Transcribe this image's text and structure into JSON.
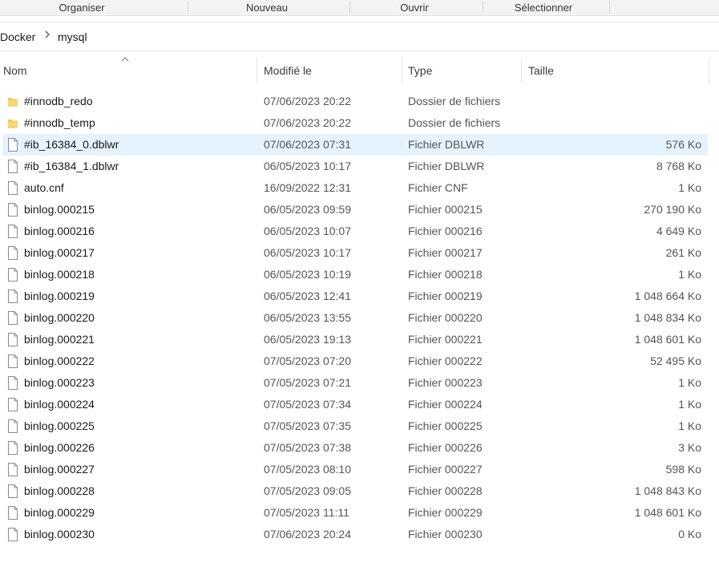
{
  "ribbon": {
    "organiser": "Organiser",
    "nouveau": "Nouveau",
    "ouvrir": "Ouvrir",
    "selectionner": "Sélectionner"
  },
  "breadcrumb": {
    "parent": "Docker",
    "current": "mysql"
  },
  "columns": {
    "name": "Nom",
    "modified": "Modifié le",
    "type": "Type",
    "size": "Taille"
  },
  "colors": {
    "selected_row": "#e5f3ff",
    "folder": "#f2c94c"
  },
  "files": [
    {
      "name": "#innodb_redo",
      "modified": "07/06/2023 20:22",
      "type": "Dossier de fichiers",
      "size": "",
      "icon": "folder-icon"
    },
    {
      "name": "#innodb_temp",
      "modified": "07/06/2023 20:22",
      "type": "Dossier de fichiers",
      "size": "",
      "icon": "folder-icon"
    },
    {
      "name": "#ib_16384_0.dblwr",
      "modified": "07/06/2023 07:31",
      "type": "Fichier DBLWR",
      "size": "576 Ko",
      "icon": "file-icon"
    },
    {
      "name": "#ib_16384_1.dblwr",
      "modified": "06/05/2023 10:17",
      "type": "Fichier DBLWR",
      "size": "8 768 Ko",
      "icon": "file-icon"
    },
    {
      "name": "auto.cnf",
      "modified": "16/09/2022 12:31",
      "type": "Fichier CNF",
      "size": "1 Ko",
      "icon": "file-icon"
    },
    {
      "name": "binlog.000215",
      "modified": "06/05/2023 09:59",
      "type": "Fichier 000215",
      "size": "270 190 Ko",
      "icon": "file-icon"
    },
    {
      "name": "binlog.000216",
      "modified": "06/05/2023 10:07",
      "type": "Fichier 000216",
      "size": "4 649 Ko",
      "icon": "file-icon"
    },
    {
      "name": "binlog.000217",
      "modified": "06/05/2023 10:17",
      "type": "Fichier 000217",
      "size": "261 Ko",
      "icon": "file-icon"
    },
    {
      "name": "binlog.000218",
      "modified": "06/05/2023 10:19",
      "type": "Fichier 000218",
      "size": "1 Ko",
      "icon": "file-icon"
    },
    {
      "name": "binlog.000219",
      "modified": "06/05/2023 12:41",
      "type": "Fichier 000219",
      "size": "1 048 664 Ko",
      "icon": "file-icon"
    },
    {
      "name": "binlog.000220",
      "modified": "06/05/2023 13:55",
      "type": "Fichier 000220",
      "size": "1 048 834 Ko",
      "icon": "file-icon"
    },
    {
      "name": "binlog.000221",
      "modified": "06/05/2023 19:13",
      "type": "Fichier 000221",
      "size": "1 048 601 Ko",
      "icon": "file-icon"
    },
    {
      "name": "binlog.000222",
      "modified": "07/05/2023 07:20",
      "type": "Fichier 000222",
      "size": "52 495 Ko",
      "icon": "file-icon"
    },
    {
      "name": "binlog.000223",
      "modified": "07/05/2023 07:21",
      "type": "Fichier 000223",
      "size": "1 Ko",
      "icon": "file-icon"
    },
    {
      "name": "binlog.000224",
      "modified": "07/05/2023 07:34",
      "type": "Fichier 000224",
      "size": "1 Ko",
      "icon": "file-icon"
    },
    {
      "name": "binlog.000225",
      "modified": "07/05/2023 07:35",
      "type": "Fichier 000225",
      "size": "1 Ko",
      "icon": "file-icon"
    },
    {
      "name": "binlog.000226",
      "modified": "07/05/2023 07:38",
      "type": "Fichier 000226",
      "size": "3 Ko",
      "icon": "file-icon"
    },
    {
      "name": "binlog.000227",
      "modified": "07/05/2023 08:10",
      "type": "Fichier 000227",
      "size": "598 Ko",
      "icon": "file-icon"
    },
    {
      "name": "binlog.000228",
      "modified": "07/05/2023 09:05",
      "type": "Fichier 000228",
      "size": "1 048 843 Ko",
      "icon": "file-icon"
    },
    {
      "name": "binlog.000229",
      "modified": "07/05/2023 11:11",
      "type": "Fichier 000229",
      "size": "1 048 601 Ko",
      "icon": "file-icon"
    },
    {
      "name": "binlog.000230",
      "modified": "07/06/2023 20:24",
      "type": "Fichier 000230",
      "size": "0 Ko",
      "icon": "file-icon"
    }
  ],
  "selected_index": 2
}
